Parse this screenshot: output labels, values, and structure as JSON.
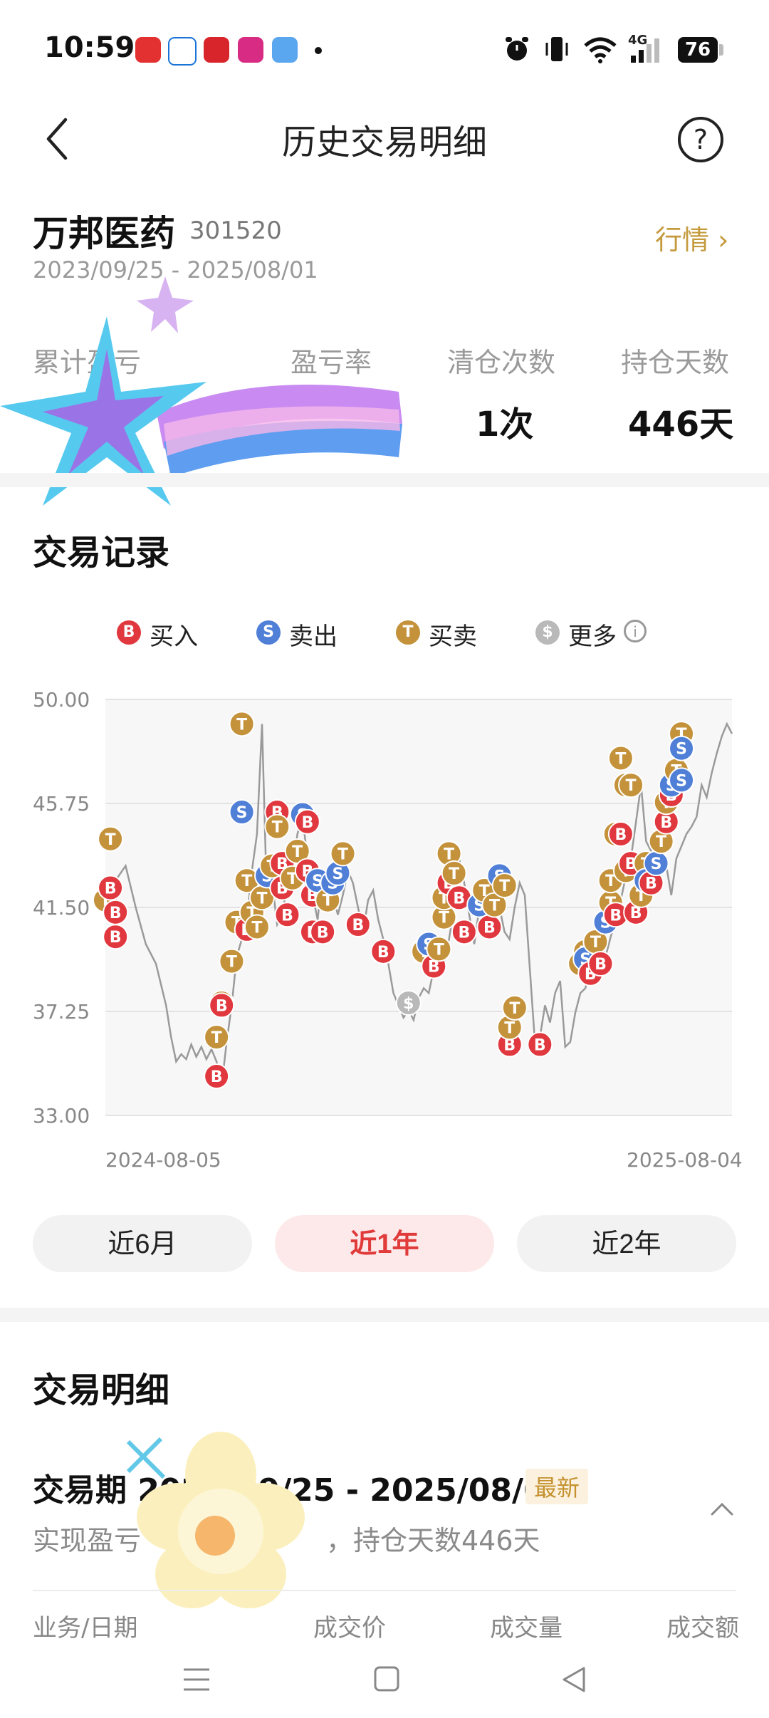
{
  "status_bar": {
    "time": "10:59",
    "network": "4G",
    "battery": "76",
    "app_icons": [
      "shopping-heart-icon",
      "telecom-icon",
      "app-icon-red",
      "app-icon-magenta",
      "weather-icon"
    ],
    "right_icons": [
      "alarm-icon",
      "vibrate-icon",
      "wifi-icon",
      "signal-icon"
    ]
  },
  "header": {
    "title": "历史交易明细",
    "back_icon": "chevron-left-icon",
    "help_icon": "question-circle-icon",
    "help_glyph": "?"
  },
  "stock": {
    "name": "万邦医药",
    "code": "301520",
    "range": "2023/09/25 - 2025/08/01",
    "market_link": "行情 ›"
  },
  "stats": [
    {
      "label": "累计盈亏",
      "value": ""
    },
    {
      "label": "盈亏率",
      "value": ""
    },
    {
      "label": "清仓次数",
      "value": "1次"
    },
    {
      "label": "持仓天数",
      "value": "446天"
    }
  ],
  "trade_record": {
    "title": "交易记录",
    "legend": [
      {
        "glyph": "B",
        "label": "买入",
        "color": "#e0383e"
      },
      {
        "glyph": "S",
        "label": "卖出",
        "color": "#4f7fd6"
      },
      {
        "glyph": "T",
        "label": "买卖",
        "color": "#c4923b"
      },
      {
        "glyph": "$",
        "label": "更多",
        "color": "#b9b9b9"
      }
    ],
    "info_glyph": "i"
  },
  "chart_data": {
    "type": "line",
    "y_ticks": [
      "50.00",
      "45.75",
      "41.50",
      "37.25",
      "33.00"
    ],
    "ylim": [
      33.0,
      50.0
    ],
    "x_start": "2024-08-05",
    "x_end": "2025-08-04",
    "grid": true,
    "price": [
      [
        0,
        42.0
      ],
      [
        4,
        43.2
      ],
      [
        6,
        41.5
      ],
      [
        8,
        40.0
      ],
      [
        10,
        39.2
      ],
      [
        12,
        37.5
      ],
      [
        13,
        36.2
      ],
      [
        14,
        35.2
      ],
      [
        15,
        35.5
      ],
      [
        16,
        35.3
      ],
      [
        17,
        35.9
      ],
      [
        18,
        35.4
      ],
      [
        19,
        35.8
      ],
      [
        20,
        35.3
      ],
      [
        21,
        35.7
      ],
      [
        22,
        35.2
      ],
      [
        23,
        34.2
      ],
      [
        24,
        36.0
      ],
      [
        25,
        37.5
      ],
      [
        26,
        39.5
      ],
      [
        27,
        40.2
      ],
      [
        28,
        41.0
      ],
      [
        29,
        43.0
      ],
      [
        30,
        44.5
      ],
      [
        31,
        49.0
      ],
      [
        32,
        41.5
      ],
      [
        33,
        42.5
      ],
      [
        34,
        40.8
      ],
      [
        35,
        41.2
      ],
      [
        36,
        42.5
      ],
      [
        37,
        43.0
      ],
      [
        38,
        44.5
      ],
      [
        39,
        45.2
      ],
      [
        40,
        43.5
      ],
      [
        41,
        42.0
      ],
      [
        42,
        41.0
      ],
      [
        43,
        43.0
      ],
      [
        44,
        42.8
      ],
      [
        45,
        42.0
      ],
      [
        46,
        41.2
      ],
      [
        47,
        42.0
      ],
      [
        48,
        43.0
      ],
      [
        49,
        42.5
      ],
      [
        50,
        41.5
      ],
      [
        51,
        40.5
      ],
      [
        52,
        41.8
      ],
      [
        53,
        42.2
      ],
      [
        54,
        41.0
      ],
      [
        55,
        40.2
      ],
      [
        56,
        39.2
      ],
      [
        57,
        38.0
      ],
      [
        58,
        37.5
      ],
      [
        59,
        37.0
      ],
      [
        60,
        37.3
      ],
      [
        61,
        36.9
      ],
      [
        62,
        37.8
      ],
      [
        63,
        38.2
      ],
      [
        64,
        38.0
      ],
      [
        65,
        39.0
      ],
      [
        66,
        39.7
      ],
      [
        67,
        39.2
      ],
      [
        68,
        40.2
      ],
      [
        69,
        41.5
      ],
      [
        70,
        43.5
      ],
      [
        71,
        42.5
      ],
      [
        72,
        41.2
      ],
      [
        73,
        40.0
      ],
      [
        74,
        41.5
      ],
      [
        75,
        41.8
      ],
      [
        76,
        41.2
      ],
      [
        77,
        42.0
      ],
      [
        78,
        41.5
      ],
      [
        79,
        40.5
      ],
      [
        80,
        40.2
      ],
      [
        81,
        41.5
      ],
      [
        82,
        42.5
      ],
      [
        83,
        42.0
      ],
      [
        84,
        39.0
      ],
      [
        85,
        36.0
      ],
      [
        86,
        36.2
      ],
      [
        87,
        37.5
      ],
      [
        88,
        36.8
      ],
      [
        89,
        38.0
      ],
      [
        90,
        38.5
      ],
      [
        91,
        35.8
      ],
      [
        92,
        36.0
      ],
      [
        93,
        37.2
      ],
      [
        94,
        38.0
      ],
      [
        95,
        38.2
      ],
      [
        96,
        39.2
      ],
      [
        97,
        39.8
      ],
      [
        98,
        40.0
      ],
      [
        99,
        39.5
      ],
      [
        100,
        40.3
      ],
      [
        101,
        41.0
      ],
      [
        102,
        41.8
      ],
      [
        103,
        42.8
      ],
      [
        104,
        43.5
      ],
      [
        105,
        45.0
      ],
      [
        106,
        46.5
      ],
      [
        107,
        44.2
      ],
      [
        108,
        43.8
      ],
      [
        109,
        42.8
      ],
      [
        110,
        43.0
      ],
      [
        111,
        43.2
      ],
      [
        112,
        42.0
      ],
      [
        113,
        43.5
      ],
      [
        114,
        44.0
      ],
      [
        115,
        44.5
      ],
      [
        116,
        44.8
      ],
      [
        117,
        45.2
      ],
      [
        118,
        46.5
      ],
      [
        119,
        46.0
      ],
      [
        120,
        47.0
      ],
      [
        121,
        47.8
      ],
      [
        122,
        48.5
      ],
      [
        123,
        49.0
      ],
      [
        124,
        48.6
      ]
    ],
    "markers": [
      {
        "t": 0,
        "p": 41.8,
        "g": "T"
      },
      {
        "t": 1,
        "p": 44.3,
        "g": "T"
      },
      {
        "t": 1,
        "p": 42.3,
        "g": "B"
      },
      {
        "t": 2,
        "p": 41.3,
        "g": "B"
      },
      {
        "t": 2,
        "p": 40.3,
        "g": "B"
      },
      {
        "t": 22,
        "p": 36.2,
        "g": "T"
      },
      {
        "t": 22,
        "p": 34.6,
        "g": "B"
      },
      {
        "t": 23,
        "p": 37.6,
        "g": "T"
      },
      {
        "t": 23,
        "p": 37.5,
        "g": "B"
      },
      {
        "t": 25,
        "p": 39.3,
        "g": "T"
      },
      {
        "t": 26,
        "p": 40.9,
        "g": "T"
      },
      {
        "t": 27,
        "p": 45.4,
        "g": "S"
      },
      {
        "t": 27,
        "p": 49.0,
        "g": "T"
      },
      {
        "t": 28,
        "p": 42.6,
        "g": "T"
      },
      {
        "t": 28,
        "p": 40.6,
        "g": "B"
      },
      {
        "t": 29,
        "p": 41.3,
        "g": "T"
      },
      {
        "t": 30,
        "p": 40.7,
        "g": "T"
      },
      {
        "t": 31,
        "p": 41.9,
        "g": "T"
      },
      {
        "t": 32,
        "p": 42.8,
        "g": "S"
      },
      {
        "t": 33,
        "p": 43.2,
        "g": "T"
      },
      {
        "t": 34,
        "p": 45.4,
        "g": "B"
      },
      {
        "t": 34,
        "p": 44.8,
        "g": "T"
      },
      {
        "t": 35,
        "p": 43.3,
        "g": "B"
      },
      {
        "t": 35,
        "p": 42.3,
        "g": "B"
      },
      {
        "t": 36,
        "p": 41.2,
        "g": "B"
      },
      {
        "t": 37,
        "p": 42.7,
        "g": "T"
      },
      {
        "t": 38,
        "p": 43.8,
        "g": "T"
      },
      {
        "t": 39,
        "p": 45.3,
        "g": "S"
      },
      {
        "t": 40,
        "p": 45.0,
        "g": "B"
      },
      {
        "t": 40,
        "p": 43.0,
        "g": "B"
      },
      {
        "t": 41,
        "p": 42.0,
        "g": "B"
      },
      {
        "t": 41,
        "p": 40.5,
        "g": "B"
      },
      {
        "t": 42,
        "p": 42.6,
        "g": "S"
      },
      {
        "t": 43,
        "p": 40.5,
        "g": "B"
      },
      {
        "t": 44,
        "p": 41.8,
        "g": "T"
      },
      {
        "t": 45,
        "p": 42.5,
        "g": "S"
      },
      {
        "t": 46,
        "p": 42.9,
        "g": "S"
      },
      {
        "t": 47,
        "p": 43.7,
        "g": "T"
      },
      {
        "t": 50,
        "p": 40.8,
        "g": "B"
      },
      {
        "t": 55,
        "p": 39.7,
        "g": "B"
      },
      {
        "t": 60,
        "p": 37.6,
        "g": "$"
      },
      {
        "t": 63,
        "p": 39.7,
        "g": "T"
      },
      {
        "t": 64,
        "p": 40.0,
        "g": "S"
      },
      {
        "t": 65,
        "p": 39.1,
        "g": "B"
      },
      {
        "t": 66,
        "p": 39.8,
        "g": "T"
      },
      {
        "t": 67,
        "p": 41.1,
        "g": "T"
      },
      {
        "t": 67,
        "p": 41.9,
        "g": "T"
      },
      {
        "t": 68,
        "p": 43.7,
        "g": "T"
      },
      {
        "t": 68,
        "p": 42.5,
        "g": "B"
      },
      {
        "t": 69,
        "p": 42.9,
        "g": "T"
      },
      {
        "t": 70,
        "p": 41.9,
        "g": "B"
      },
      {
        "t": 71,
        "p": 40.5,
        "g": "B"
      },
      {
        "t": 74,
        "p": 41.6,
        "g": "S"
      },
      {
        "t": 75,
        "p": 42.2,
        "g": "T"
      },
      {
        "t": 76,
        "p": 40.7,
        "g": "B"
      },
      {
        "t": 77,
        "p": 41.6,
        "g": "T"
      },
      {
        "t": 78,
        "p": 42.8,
        "g": "S"
      },
      {
        "t": 79,
        "p": 42.4,
        "g": "T"
      },
      {
        "t": 80,
        "p": 35.9,
        "g": "B"
      },
      {
        "t": 80,
        "p": 36.6,
        "g": "T"
      },
      {
        "t": 81,
        "p": 37.4,
        "g": "T"
      },
      {
        "t": 86,
        "p": 35.9,
        "g": "B"
      },
      {
        "t": 94,
        "p": 39.2,
        "g": "T"
      },
      {
        "t": 95,
        "p": 39.7,
        "g": "T"
      },
      {
        "t": 95,
        "p": 39.4,
        "g": "S"
      },
      {
        "t": 96,
        "p": 38.8,
        "g": "B"
      },
      {
        "t": 97,
        "p": 40.1,
        "g": "T"
      },
      {
        "t": 98,
        "p": 39.2,
        "g": "B"
      },
      {
        "t": 99,
        "p": 40.9,
        "g": "S"
      },
      {
        "t": 100,
        "p": 41.7,
        "g": "T"
      },
      {
        "t": 100,
        "p": 42.6,
        "g": "T"
      },
      {
        "t": 101,
        "p": 41.2,
        "g": "B"
      },
      {
        "t": 101,
        "p": 44.5,
        "g": "T"
      },
      {
        "t": 102,
        "p": 44.5,
        "g": "B"
      },
      {
        "t": 102,
        "p": 47.6,
        "g": "T"
      },
      {
        "t": 103,
        "p": 46.5,
        "g": "T"
      },
      {
        "t": 103,
        "p": 43.0,
        "g": "T"
      },
      {
        "t": 104,
        "p": 43.3,
        "g": "B"
      },
      {
        "t": 104,
        "p": 46.5,
        "g": "T"
      },
      {
        "t": 105,
        "p": 41.3,
        "g": "B"
      },
      {
        "t": 106,
        "p": 42.0,
        "g": "T"
      },
      {
        "t": 107,
        "p": 43.3,
        "g": "T"
      },
      {
        "t": 107,
        "p": 42.6,
        "g": "S"
      },
      {
        "t": 108,
        "p": 42.5,
        "g": "B"
      },
      {
        "t": 109,
        "p": 43.3,
        "g": "S"
      },
      {
        "t": 110,
        "p": 44.2,
        "g": "T"
      },
      {
        "t": 111,
        "p": 45.0,
        "g": "B"
      },
      {
        "t": 111,
        "p": 45.8,
        "g": "T"
      },
      {
        "t": 112,
        "p": 46.1,
        "g": "B"
      },
      {
        "t": 112,
        "p": 46.5,
        "g": "S"
      },
      {
        "t": 113,
        "p": 47.1,
        "g": "T"
      },
      {
        "t": 114,
        "p": 46.7,
        "g": "S"
      },
      {
        "t": 114,
        "p": 48.6,
        "g": "T"
      },
      {
        "t": 114,
        "p": 48.0,
        "g": "S"
      }
    ]
  },
  "periods": [
    "近6月",
    "近1年",
    "近2年"
  ],
  "active_period": 1,
  "trade_detail": {
    "title": "交易明细",
    "period_label": "交易期 2023/09/25 - 2025/08/01",
    "badge": "最新",
    "realized_label": "实现盈亏",
    "hold_days": "，持仓天数446天",
    "columns": [
      "业务/日期",
      "成交价",
      "成交量",
      "成交额"
    ]
  },
  "colors": {
    "accent_gold": "#c49a3c",
    "buy_red": "#e0383e",
    "sell_blue": "#4f7fd6",
    "both_gold": "#c4923b",
    "more_gray": "#b9b9b9"
  }
}
